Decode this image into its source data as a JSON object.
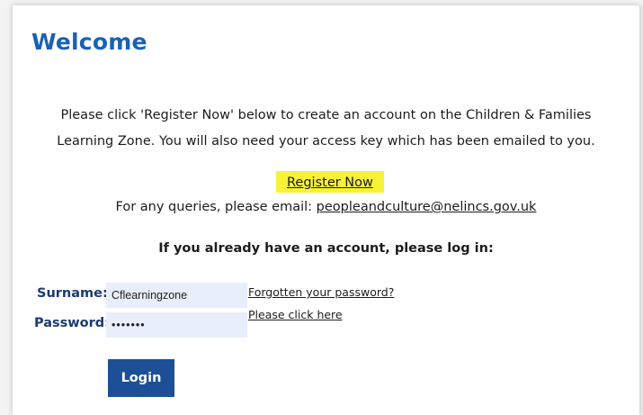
{
  "page": {
    "title": "Welcome"
  },
  "intro": {
    "line1": "Please click 'Register Now' below to create an account on the Children & Families",
    "line2": "Learning Zone. You will also need your access key which has been emailed to you."
  },
  "register": {
    "label": "Register Now",
    "highlight_color": "#f7f238"
  },
  "queries": {
    "prefix": "For any queries, please email: ",
    "email": "peopleandculture@nelincs.gov.uk"
  },
  "login": {
    "prompt": "If you already have an account, please log in:",
    "surname_label": "Surname:",
    "surname_value": "Cflearningzone",
    "password_label": "Password:",
    "password_value": "•••••••",
    "forgot_link": "Forgotten your password?",
    "click_here_link": "Please click here",
    "button_label": "Login"
  },
  "colors": {
    "heading": "#1b61b6",
    "label": "#1a3b73",
    "button": "#1d4f96",
    "field_bg": "#e8eefb"
  }
}
